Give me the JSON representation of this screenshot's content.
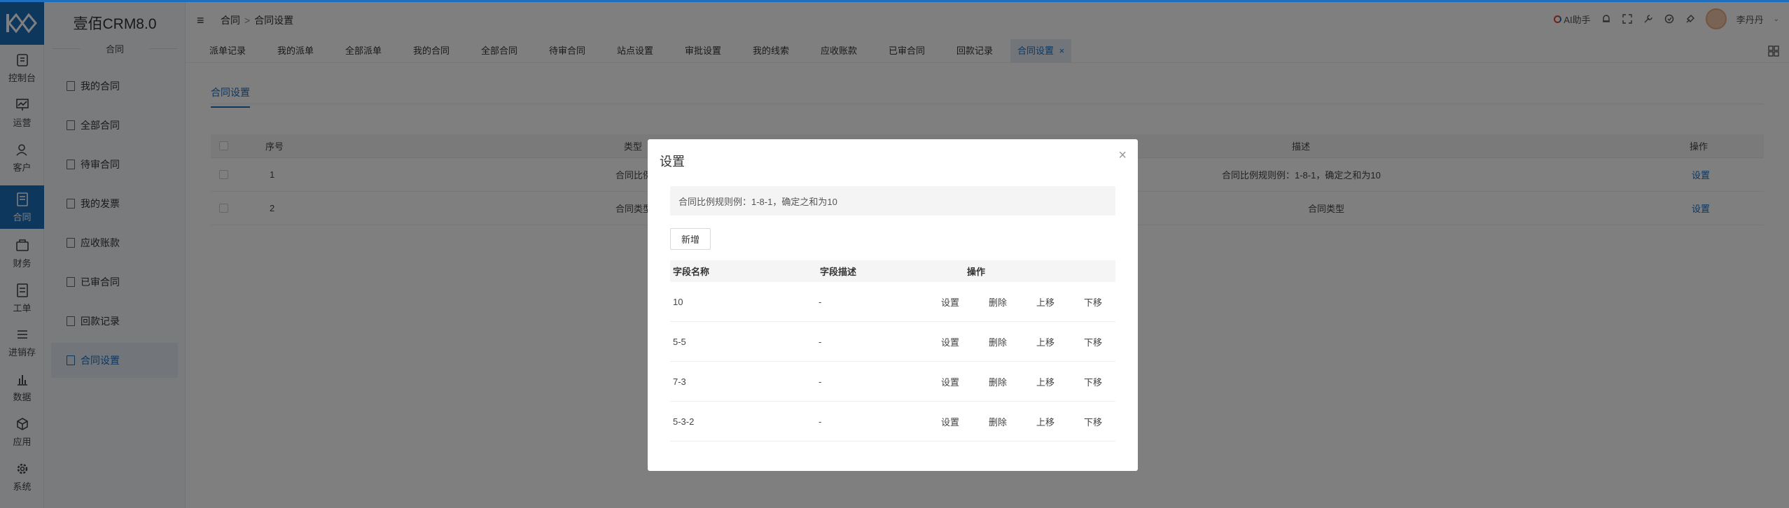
{
  "app": {
    "brand": "壹佰CRM8.0",
    "group": "合同"
  },
  "rail": [
    {
      "label": "控制台",
      "icon": "dashboard-icon"
    },
    {
      "label": "运营",
      "icon": "chart-icon"
    },
    {
      "label": "客户",
      "icon": "user-icon"
    },
    {
      "label": "合同",
      "icon": "contract-icon"
    },
    {
      "label": "财务",
      "icon": "finance-icon"
    },
    {
      "label": "工单",
      "icon": "ticket-icon"
    },
    {
      "label": "进销存",
      "icon": "inventory-icon"
    },
    {
      "label": "数据",
      "icon": "data-icon"
    },
    {
      "label": "应用",
      "icon": "app-icon"
    },
    {
      "label": "系统",
      "icon": "system-icon"
    }
  ],
  "sidebar": [
    {
      "label": "我的合同"
    },
    {
      "label": "全部合同"
    },
    {
      "label": "待审合同"
    },
    {
      "label": "我的发票"
    },
    {
      "label": "应收账款"
    },
    {
      "label": "已审合同"
    },
    {
      "label": "回款记录"
    },
    {
      "label": "合同设置"
    }
  ],
  "breadcrumb": {
    "root": "合同",
    "sep": ">",
    "current": "合同设置"
  },
  "header": {
    "assistant": "AI助手",
    "user": "李丹丹"
  },
  "tabs": [
    {
      "label": "派单记录"
    },
    {
      "label": "我的派单"
    },
    {
      "label": "全部派单"
    },
    {
      "label": "我的合同"
    },
    {
      "label": "全部合同"
    },
    {
      "label": "待审合同"
    },
    {
      "label": "站点设置"
    },
    {
      "label": "审批设置"
    },
    {
      "label": "我的线索"
    },
    {
      "label": "应收账款"
    },
    {
      "label": "已审合同"
    },
    {
      "label": "回款记录"
    },
    {
      "label": "合同设置",
      "close": "×"
    }
  ],
  "page": {
    "inner_tab": "合同设置",
    "columns": {
      "seq": "序号",
      "type": "类型",
      "desc": "描述",
      "op": "操作"
    },
    "rows": [
      {
        "seq": "1",
        "type": "合同比例",
        "desc": "合同比例规则例：1-8-1，确定之和为10",
        "op": "设置"
      },
      {
        "seq": "2",
        "type": "合同类型",
        "desc": "合同类型",
        "op": "设置"
      }
    ]
  },
  "modal": {
    "title": "设置",
    "close": "×",
    "note": "合同比例规则例：1-8-1，确定之和为10",
    "add_label": "新增",
    "columns": {
      "name": "字段名称",
      "desc": "字段描述",
      "op": "操作"
    },
    "actions": {
      "set": "设置",
      "delete": "删除",
      "up": "上移",
      "down": "下移"
    },
    "rows": [
      {
        "name": "10",
        "desc": "-"
      },
      {
        "name": "5-5",
        "desc": "-"
      },
      {
        "name": "7-3",
        "desc": "-"
      },
      {
        "name": "5-3-2",
        "desc": "-"
      }
    ]
  },
  "colors": {
    "accent": "#1d6fbd",
    "overlay": "rgba(0,0,0,0.5)"
  }
}
